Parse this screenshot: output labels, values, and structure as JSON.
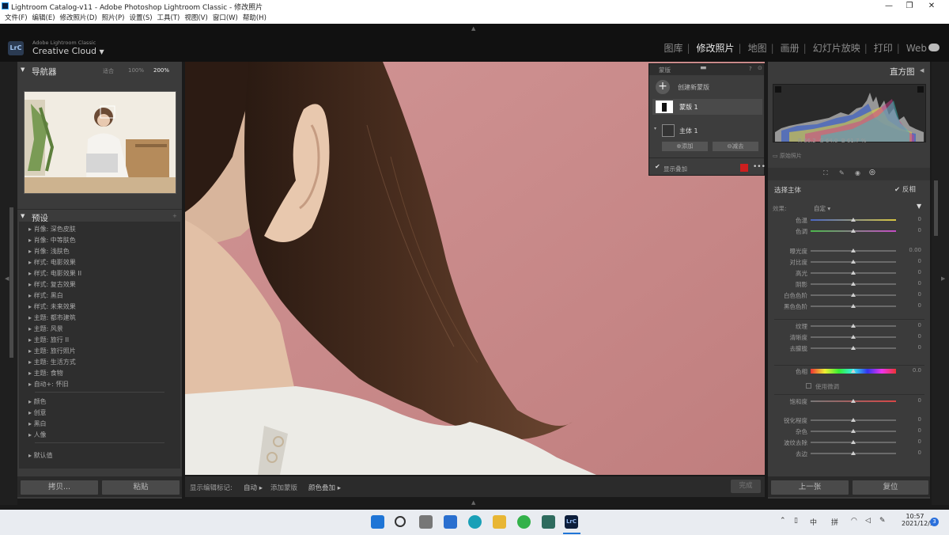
{
  "window": {
    "title": "Adobe Photoshop Lightroom Classic - 修改照片",
    "catalog": "Lightroom Catalog-v11"
  },
  "menu": [
    "文件(F)",
    "编辑(E)",
    "修改照片(D)",
    "照片(P)",
    "设置(S)",
    "工具(T)",
    "视图(V)",
    "窗口(W)",
    "帮助(H)"
  ],
  "brand": {
    "logo": "LrC",
    "line1": "Adobe Lightroom Classic",
    "line2": "Creative Cloud"
  },
  "modules": [
    "图库",
    "修改照片",
    "地图",
    "画册",
    "幻灯片放映",
    "打印",
    "Web"
  ],
  "active_module": "修改照片",
  "navigator": {
    "title": "导航器",
    "fit": "适合",
    "zoom1": "100%",
    "zoom2": "200%"
  },
  "presets": {
    "title": "预设",
    "items": [
      "肖像: 深色皮肤",
      "肖像: 中等肤色",
      "肖像: 浅肤色",
      "样式: 电影效果",
      "样式: 电影效果 II",
      "样式: 复古效果",
      "样式: 黑白",
      "样式: 未来效果",
      "主题: 都市建筑",
      "主题: 风景",
      "主题: 旅行 II",
      "主题: 旅行照片",
      "主题: 生活方式",
      "主题: 食物",
      "自动+: 怀旧"
    ],
    "groups": [
      "颜色",
      "创意",
      "黑白",
      "人像"
    ],
    "default": "默认值"
  },
  "left_buttons": {
    "copy": "拷贝...",
    "paste": "粘贴"
  },
  "bottom_toolbar": {
    "show_pins": "显示编辑标记:",
    "auto": "自动",
    "add_mask": "添加蒙版",
    "overlay": "颜色叠加",
    "done": "完成"
  },
  "mask_panel": {
    "title": "蒙版",
    "create": "创建新蒙版",
    "mask_name": "蒙版 1",
    "subject": "主体 1",
    "add": "添加",
    "subtract": "减去",
    "show_overlay": "显示叠加",
    "overlay_color": "#cc1f1f"
  },
  "histogram": {
    "title": "直方图",
    "r_label": "R",
    "r": "66.2",
    "g_label": "G",
    "g": "64.0",
    "b_label": "B",
    "b": "61.7",
    "percent": "%",
    "original": "原始照片"
  },
  "adjust": {
    "title": "选择主体",
    "invert": "反相",
    "effect_label": "效果:",
    "effect_value": "自定",
    "sliders": [
      {
        "label": "色温",
        "value": "0"
      },
      {
        "label": "色调",
        "value": "0"
      },
      {
        "label": "曝光度",
        "value": "0.00"
      },
      {
        "label": "对比度",
        "value": "0"
      },
      {
        "label": "高光",
        "value": "0"
      },
      {
        "label": "阴影",
        "value": "0"
      },
      {
        "label": "白色色阶",
        "value": "0"
      },
      {
        "label": "黑色色阶",
        "value": "0"
      },
      {
        "label": "纹理",
        "value": "0"
      },
      {
        "label": "清晰度",
        "value": "0"
      },
      {
        "label": "去朦胧",
        "value": "0"
      },
      {
        "label": "色相",
        "value": "0.0"
      },
      {
        "label": "饱和度",
        "value": "0"
      },
      {
        "label": "锐化程度",
        "value": "0"
      },
      {
        "label": "杂色",
        "value": "0"
      },
      {
        "label": "波纹去除",
        "value": "0"
      },
      {
        "label": "去边",
        "value": "0"
      }
    ],
    "fine_adjust": "使用微调"
  },
  "right_buttons": {
    "prev": "上一张",
    "reset": "复位"
  },
  "taskbar": {
    "time": "10:57",
    "date": "2021/12/3",
    "ime1": "中",
    "ime2": "拼",
    "badge": "3"
  }
}
